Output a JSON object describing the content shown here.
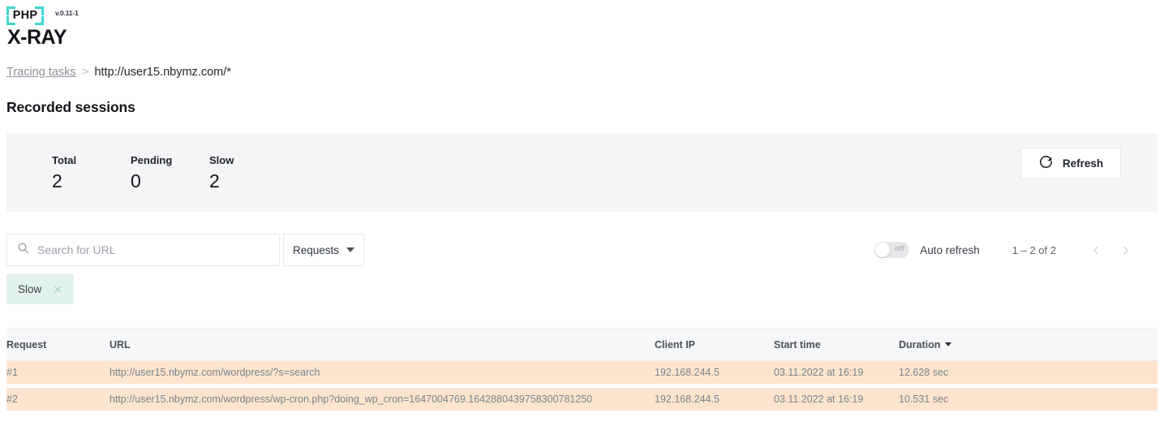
{
  "app": {
    "logo_text": "PHP",
    "logo_name": "X-RAY",
    "version": "v.0.11-1",
    "accent_color": "#3fd8cf"
  },
  "breadcrumb": {
    "parent": "Tracing tasks",
    "separator": ">",
    "current": "http://user15.nbymz.com/*"
  },
  "page": {
    "title": "Recorded sessions"
  },
  "stats": {
    "items": [
      {
        "label": "Total",
        "value": "2"
      },
      {
        "label": "Pending",
        "value": "0"
      },
      {
        "label": "Slow",
        "value": "2"
      }
    ],
    "refresh_label": "Refresh",
    "refresh_icon": "refresh-icon",
    "panel_color": "#f4f5f7"
  },
  "filters": {
    "search_placeholder": "Search for URL",
    "search_value": "",
    "search_icon": "search-icon",
    "dropdown_label": "Requests",
    "dropdown_icon": "chevron-down-icon",
    "chips": [
      {
        "label": "Slow",
        "close_icon": "close-icon",
        "color": "#e4f2ee"
      }
    ]
  },
  "controls": {
    "auto_refresh_label": "Auto refresh",
    "auto_refresh_state": "off",
    "page_info": "1 – 2 of 2",
    "prev_icon": "chevron-left-icon",
    "next_icon": "chevron-right-icon"
  },
  "table": {
    "columns": [
      {
        "key": "request",
        "label": "Request",
        "sorted": false
      },
      {
        "key": "url",
        "label": "URL",
        "sorted": false
      },
      {
        "key": "client_ip",
        "label": "Client IP",
        "sorted": false
      },
      {
        "key": "start_time",
        "label": "Start time",
        "sorted": false
      },
      {
        "key": "duration",
        "label": "Duration",
        "sorted": true,
        "sort_dir": "desc"
      }
    ],
    "rows": [
      {
        "request": "#1",
        "url": "http://user15.nbymz.com/wordpress/?s=search",
        "client_ip": "192.168.244.5",
        "start_time": "03.11.2022 at 16:19",
        "duration": "12.628 sec"
      },
      {
        "request": "#2",
        "url": "http://user15.nbymz.com/wordpress/wp-cron.php?doing_wp_cron=1647004769.1642880439758300781250",
        "client_ip": "192.168.244.5",
        "start_time": "03.11.2022 at 16:19",
        "duration": "10.531 sec"
      }
    ],
    "row_highlight_color": "#fde4cf",
    "duration_color": "#ef9a32"
  }
}
